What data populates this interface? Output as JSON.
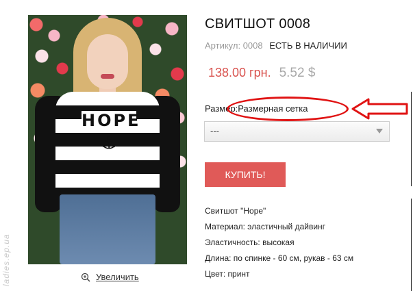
{
  "product": {
    "title": "СВИТШОТ 0008",
    "sku_label": "Артикул:",
    "sku_value": "0008",
    "availability": "ЕСТЬ В НАЛИЧИИ",
    "price_main": "138.00 грн.",
    "price_alt": "5.52 $",
    "size_label": "Размер:",
    "size_chart_link": "Размерная сетка",
    "size_select_value": "---",
    "buy_label": "КУПИТЬ!"
  },
  "image": {
    "shirt_text": "HOPE",
    "anchor_glyph": "⚓",
    "zoom_label": "Увеличить",
    "watermark": "ladies.ep.ua"
  },
  "description": [
    "Свитшот \"Hope\"",
    "Материал: эластичный дайвинг",
    "Эластичность: высокая",
    "Длина: по спинке - 60 см, рукав - 63 см",
    "Цвет: принт"
  ],
  "colors": {
    "price": "#d9534f",
    "button": "#e05a58",
    "annotation": "#e01313"
  },
  "icons": [
    "zoom-in-icon",
    "chevron-down-icon",
    "arrow-left-icon",
    "anchor-icon"
  ]
}
